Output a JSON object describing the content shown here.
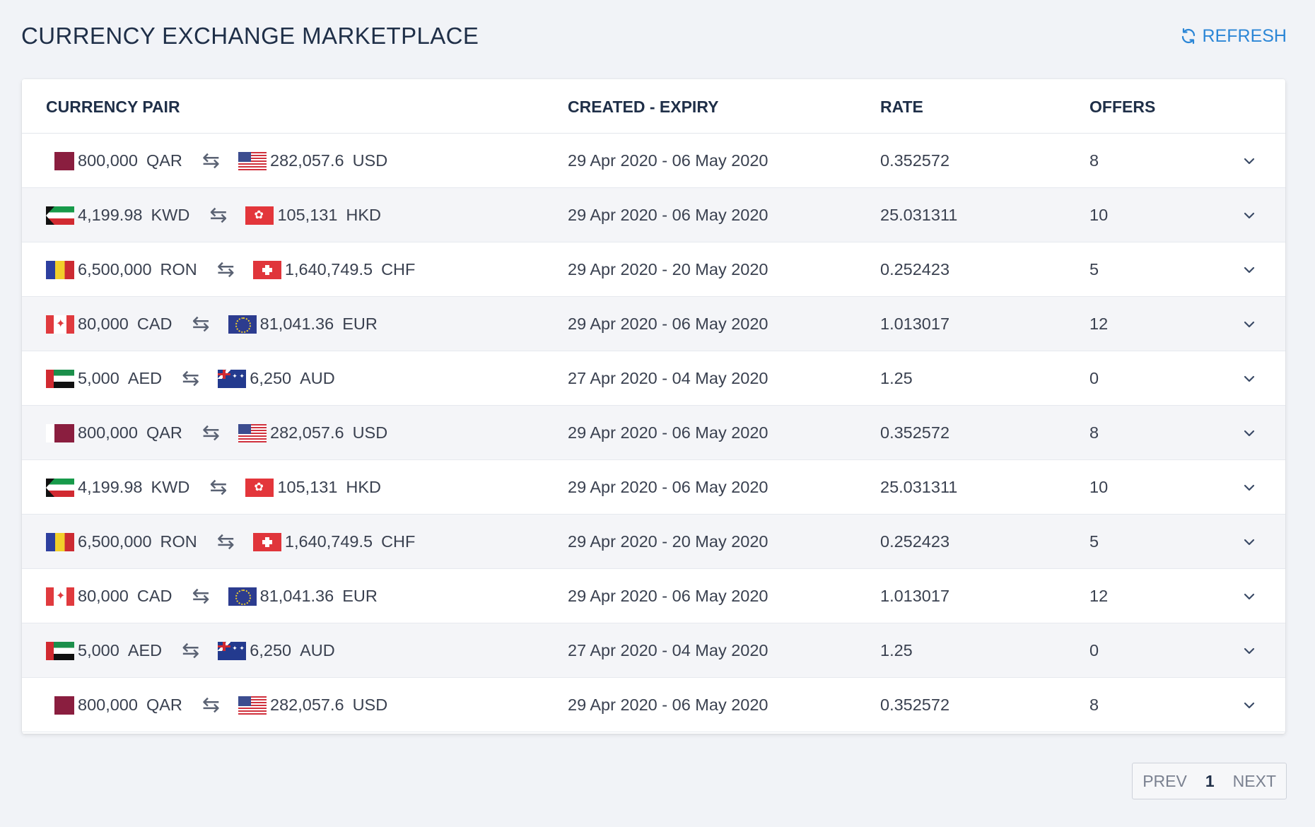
{
  "header": {
    "title": "CURRENCY EXCHANGE MARKETPLACE",
    "refresh_label": "REFRESH"
  },
  "table": {
    "columns": [
      "CURRENCY PAIR",
      "CREATED - EXPIRY",
      "RATE",
      "OFFERS"
    ],
    "rows": [
      {
        "from_flag": "qar",
        "from_amount": "800,000",
        "from_ccy": "QAR",
        "to_flag": "usa",
        "to_amount": "282,057.6",
        "to_ccy": "USD",
        "dates": "29 Apr 2020 - 06 May 2020",
        "rate": "0.352572",
        "offers": "8"
      },
      {
        "from_flag": "kwd",
        "from_amount": "4,199.98",
        "from_ccy": "KWD",
        "to_flag": "hkd",
        "to_amount": "105,131",
        "to_ccy": "HKD",
        "dates": "29 Apr 2020 - 06 May 2020",
        "rate": "25.031311",
        "offers": "10"
      },
      {
        "from_flag": "ron",
        "from_amount": "6,500,000",
        "from_ccy": "RON",
        "to_flag": "chf",
        "to_amount": "1,640,749.5",
        "to_ccy": "CHF",
        "dates": "29 Apr 2020 - 20 May 2020",
        "rate": "0.252423",
        "offers": "5"
      },
      {
        "from_flag": "cad",
        "from_amount": "80,000",
        "from_ccy": "CAD",
        "to_flag": "eur",
        "to_amount": "81,041.36",
        "to_ccy": "EUR",
        "dates": "29 Apr 2020 - 06 May 2020",
        "rate": "1.013017",
        "offers": "12"
      },
      {
        "from_flag": "aed",
        "from_amount": "5,000",
        "from_ccy": "AED",
        "to_flag": "aud",
        "to_amount": "6,250",
        "to_ccy": "AUD",
        "dates": "27 Apr 2020 - 04 May 2020",
        "rate": "1.25",
        "offers": "0"
      },
      {
        "from_flag": "qar",
        "from_amount": "800,000",
        "from_ccy": "QAR",
        "to_flag": "usa",
        "to_amount": "282,057.6",
        "to_ccy": "USD",
        "dates": "29 Apr 2020 - 06 May 2020",
        "rate": "0.352572",
        "offers": "8"
      },
      {
        "from_flag": "kwd",
        "from_amount": "4,199.98",
        "from_ccy": "KWD",
        "to_flag": "hkd",
        "to_amount": "105,131",
        "to_ccy": "HKD",
        "dates": "29 Apr 2020 - 06 May 2020",
        "rate": "25.031311",
        "offers": "10"
      },
      {
        "from_flag": "ron",
        "from_amount": "6,500,000",
        "from_ccy": "RON",
        "to_flag": "chf",
        "to_amount": "1,640,749.5",
        "to_ccy": "CHF",
        "dates": "29 Apr 2020 - 20 May 2020",
        "rate": "0.252423",
        "offers": "5"
      },
      {
        "from_flag": "cad",
        "from_amount": "80,000",
        "from_ccy": "CAD",
        "to_flag": "eur",
        "to_amount": "81,041.36",
        "to_ccy": "EUR",
        "dates": "29 Apr 2020 - 06 May 2020",
        "rate": "1.013017",
        "offers": "12"
      },
      {
        "from_flag": "aed",
        "from_amount": "5,000",
        "from_ccy": "AED",
        "to_flag": "aud",
        "to_amount": "6,250",
        "to_ccy": "AUD",
        "dates": "27 Apr 2020 - 04 May 2020",
        "rate": "1.25",
        "offers": "0"
      },
      {
        "from_flag": "qar",
        "from_amount": "800,000",
        "from_ccy": "QAR",
        "to_flag": "usa",
        "to_amount": "282,057.6",
        "to_ccy": "USD",
        "dates": "29 Apr 2020 - 06 May 2020",
        "rate": "0.352572",
        "offers": "8"
      }
    ]
  },
  "pagination": {
    "prev_label": "PREV",
    "current_page": "1",
    "next_label": "NEXT"
  },
  "icons": {
    "refresh": "refresh-icon",
    "swap": "swap-arrows-icon",
    "expand": "chevron-down-icon"
  },
  "colors": {
    "accent": "#2b86d6",
    "title": "#1f2f48",
    "background": "#f1f3f7"
  }
}
